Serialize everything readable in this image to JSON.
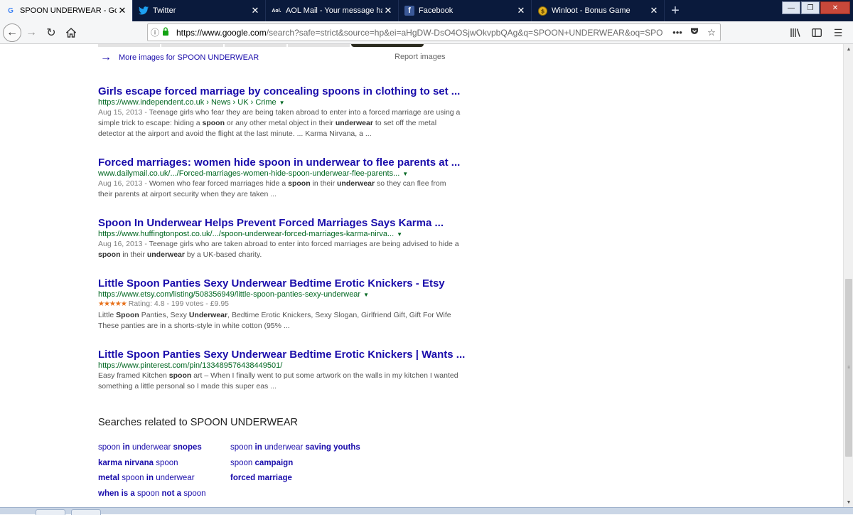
{
  "tabs": [
    {
      "title": "SPOON UNDERWEAR - Google",
      "icon": "google-icon",
      "active": true
    },
    {
      "title": "Twitter",
      "icon": "twitter-icon",
      "active": false
    },
    {
      "title": "AOL Mail - Your message has b",
      "icon": "aol-icon",
      "active": false
    },
    {
      "title": "Facebook",
      "icon": "facebook-icon",
      "active": false
    },
    {
      "title": "Winloot - Bonus Game",
      "icon": "winloot-icon",
      "active": false
    }
  ],
  "window_controls": {
    "minimize": "—",
    "restore": "❐",
    "close": "✕"
  },
  "nav": {
    "url_host": "https://www.google.com",
    "url_rest": "/search?safe=strict&source=hp&ei=aHgDW-DsO4OSjwOkvpbQAg&q=SPOON+UNDERWEAR&oq=SPO"
  },
  "images": {
    "more_label": "More images for SPOON UNDERWEAR",
    "report_label": "Report images"
  },
  "results": [
    {
      "title": "Girls escape forced marriage by concealing spoons in clothing to set ...",
      "url": "https://www.independent.co.uk › News › UK › Crime",
      "date": "Aug 15, 2013 - ",
      "snippet_1": "Teenage girls who fear they are being taken abroad to enter into a forced marriage are using a simple trick to escape: hiding a ",
      "bold_1": "spoon",
      "snippet_2": " or any other metal object in their ",
      "bold_2": "underwear",
      "snippet_3": " to set off the metal detector at the airport and avoid the flight at the last minute. ... Karma Nirvana, a ..."
    },
    {
      "title": "Forced marriages: women hide spoon in underwear to flee parents at ...",
      "url": "www.dailymail.co.uk/.../Forced-marriages-women-hide-spoon-underwear-flee-parents...",
      "date": "Aug 16, 2013 - ",
      "snippet_1": "Women who fear forced marriages hide a ",
      "bold_1": "spoon",
      "snippet_2": " in their ",
      "bold_2": "underwear",
      "snippet_3": " so they can flee from their parents at airport security when they are taken ..."
    },
    {
      "title": "Spoon In Underwear Helps Prevent Forced Marriages Says Karma ...",
      "url": "https://www.huffingtonpost.co.uk/.../spoon-underwear-forced-marriages-karma-nirva...",
      "date": "Aug 16, 2013 - ",
      "snippet_1": "Teenage girls who are taken abroad to enter into forced marriages are being advised to hide a ",
      "bold_1": "spoon",
      "snippet_2": " in their ",
      "bold_2": "underwear",
      "snippet_3": " by a UK-based charity."
    },
    {
      "title": "Little Spoon Panties Sexy Underwear Bedtime Erotic Knickers - Etsy",
      "url": "https://www.etsy.com/listing/508356949/little-spoon-panties-sexy-underwear",
      "stars": "★★★★★",
      "rating": 4.8,
      "rating_text": " Rating: 4.8 - 199 votes - £9.95",
      "snippet_1": "Little ",
      "bold_1": "Spoon",
      "snippet_2": " Panties, Sexy ",
      "bold_2": "Underwear",
      "snippet_3": ", Bedtime Erotic Knickers, Sexy Slogan, Girlfriend Gift, Gift For Wife These panties are in a shorts-style in white cotton (95% ..."
    },
    {
      "title": "Little Spoon Panties Sexy Underwear Bedtime Erotic Knickers | Wants ...",
      "url": "https://www.pinterest.com/pin/133489576438449501/",
      "snippet_1": "Easy framed Kitchen ",
      "bold_1": "spoon",
      "snippet_2": " art – When I finally went to put some artwork on the walls in my kitchen I wanted something a little personal so I made this super eas ..."
    }
  ],
  "related": {
    "heading": "Searches related to SPOON UNDERWEAR",
    "items": [
      {
        "a": "spoon ",
        "b": "in",
        "c": " underwear ",
        "d": "snopes",
        "e": ""
      },
      {
        "a": "",
        "b": "karma nirvana",
        "c": " spoon",
        "d": "",
        "e": ""
      },
      {
        "a": "",
        "b": "metal",
        "c": " spoon ",
        "d": "in",
        "e": " underwear"
      },
      {
        "a": "",
        "b": "when is a",
        "c": " spoon ",
        "d": "not a",
        "e": " spoon"
      },
      {
        "a": "spoon ",
        "b": "in",
        "c": " underwear ",
        "d": "saving youths",
        "e": ""
      },
      {
        "a": "spoon ",
        "b": "campaign",
        "c": "",
        "d": "",
        "e": ""
      },
      {
        "a": "",
        "b": "forced marriage",
        "c": "",
        "d": "",
        "e": ""
      }
    ]
  },
  "colors": {
    "link": "#1a0dab",
    "url": "#006621",
    "snippet": "#545454",
    "tabbar": "#0a1a3c",
    "stars": "#e7711b"
  }
}
